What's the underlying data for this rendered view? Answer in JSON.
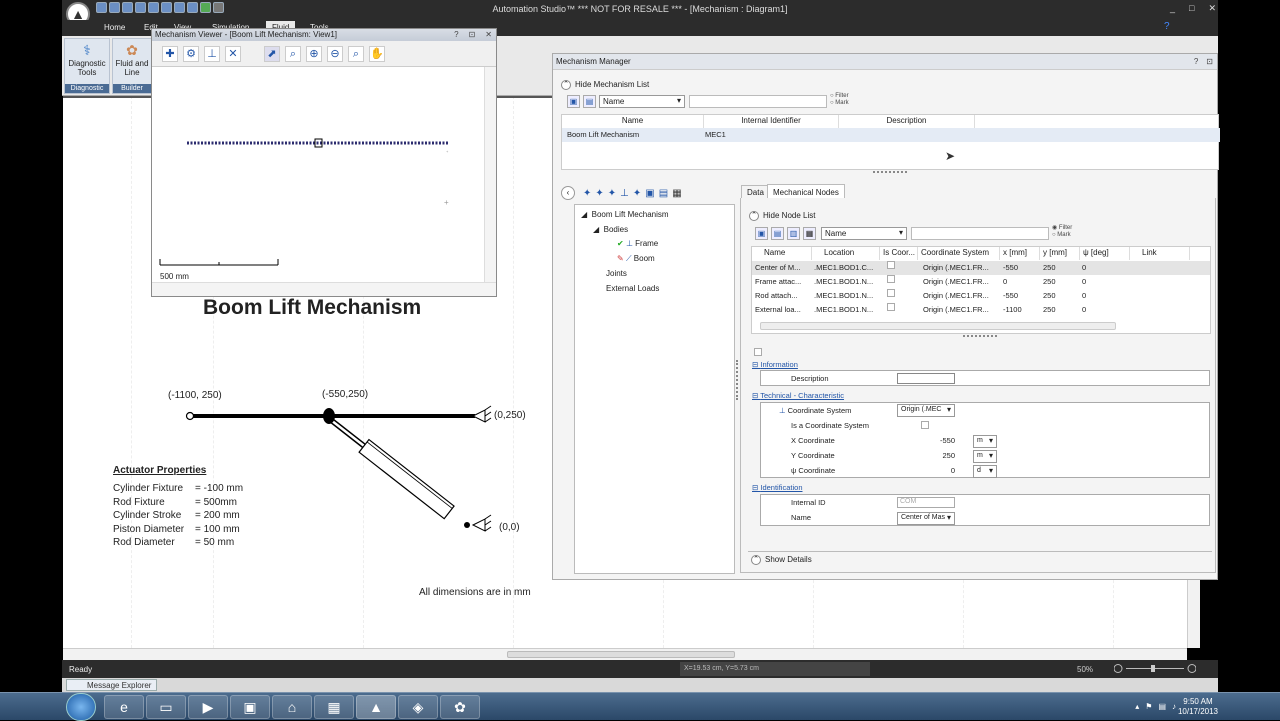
{
  "app": {
    "title": "Automation Studio™  *** NOT FOR RESALE ***   - [Mechanism : Diagram1]",
    "ribbon_tabs": [
      "Home",
      "Edit",
      "View",
      "Simulation",
      "Fluid",
      "Tools"
    ],
    "window_controls": [
      "_",
      "□",
      "✕"
    ]
  },
  "ribbon": {
    "groups": [
      {
        "label": "Diagnostic Tools",
        "group": "Diagnostic",
        "icon": "stethoscope-icon"
      },
      {
        "label": "Fluid and Line Mana...",
        "group": "Builder",
        "icon": "fluid-line-icon"
      }
    ]
  },
  "viewer": {
    "title": "Mechanism Viewer - [Boom Lift Mechanism: View1]",
    "controls": [
      "?",
      "⊡",
      "✕"
    ],
    "scale_label": "500 mm"
  },
  "canvas": {
    "title": "Boom Lift Mechanism",
    "coord_labels": [
      "(-1100, 250)",
      "(-550,250)",
      "(0,250)",
      "(0,0)"
    ],
    "actuator": {
      "heading": "Actuator Properties",
      "rows": [
        {
          "name": "Cylinder Fixture",
          "value": "=  -100 mm"
        },
        {
          "name": "Rod Fixture",
          "value": "=    500mm"
        },
        {
          "name": "Cylinder Stroke",
          "value": "=   200 mm"
        },
        {
          "name": "Piston Diameter",
          "value": "=   100 mm"
        },
        {
          "name": "Rod Diameter",
          "value": "=     50 mm"
        }
      ]
    },
    "dim_note": "All dimensions are in mm"
  },
  "manager": {
    "title": "Mechanism Manager",
    "hide_list": "Hide Mechanism List",
    "filter_select": "Name",
    "filter_radio": [
      "Filter",
      "Mark"
    ],
    "list_headers": [
      "Name",
      "Internal Identifier",
      "Description"
    ],
    "list_rows": [
      {
        "name": "Boom Lift Mechanism",
        "id": "MEC1",
        "desc": ""
      }
    ],
    "tabs": [
      "Data",
      "Mechanical Nodes"
    ],
    "tree": {
      "root": "Boom Lift Mechanism",
      "bodies": "Bodies",
      "frame": "Frame",
      "boom": "Boom",
      "joints": "Joints",
      "external": "External Loads"
    },
    "node_list": {
      "hide": "Hide Node List",
      "filter_select": "Name",
      "filter_radio": [
        "Filter",
        "Mark"
      ],
      "headers": [
        "Name",
        "Location",
        "Is Coor...",
        "Coordinate System",
        "x [mm]",
        "y [mm]",
        "ψ [deg]",
        "Link"
      ],
      "rows": [
        {
          "name": "Center of M...",
          "loc": ".MEC1.BOD1.C...",
          "cs": "Origin (.MEC1.FR...",
          "x": "-550",
          "y": "250",
          "psi": "0"
        },
        {
          "name": "Frame attac...",
          "loc": ".MEC1.BOD1.N...",
          "cs": "Origin (.MEC1.FR...",
          "x": "0",
          "y": "250",
          "psi": "0"
        },
        {
          "name": "Rod attach...",
          "loc": ".MEC1.BOD1.N...",
          "cs": "Origin (.MEC1.FR...",
          "x": "-550",
          "y": "250",
          "psi": "0"
        },
        {
          "name": "External loa...",
          "loc": ".MEC1.BOD1.N...",
          "cs": "Origin (.MEC1.FR...",
          "x": "-1100",
          "y": "250",
          "psi": "0"
        }
      ]
    },
    "props": {
      "information": "Information",
      "description": "Description",
      "technical": "Technical - Characteristic",
      "coord_system": "Coordinate System",
      "coord_system_val": "Origin (.MEC",
      "is_coord": "Is a Coordinate System",
      "x_coord": "X Coordinate",
      "x_val": "-550",
      "x_unit": "m",
      "y_coord": "Y Coordinate",
      "y_val": "250",
      "y_unit": "m",
      "psi_coord": "ψ Coordinate",
      "psi_val": "0",
      "psi_unit": "d",
      "identification": "Identification",
      "internal_id": "Internal ID",
      "internal_id_val": "COM",
      "name": "Name",
      "name_val": "Center of Mas",
      "show_details": "Show Details"
    }
  },
  "status": {
    "ready": "Ready",
    "coords": "X=19.53 cm, Y=5.73 cm",
    "zoom": "50%"
  },
  "message_explorer": "Message Explorer",
  "taskbar": {
    "time": "9:50 AM",
    "date": "10/17/2013"
  }
}
